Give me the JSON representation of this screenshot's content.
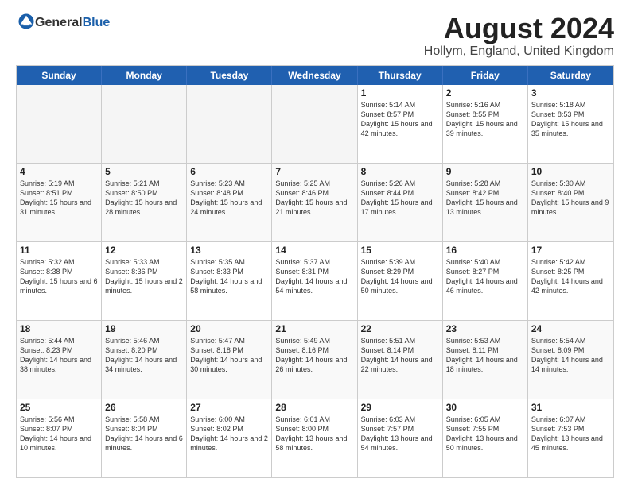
{
  "header": {
    "logo": {
      "general": "General",
      "blue": "Blue"
    },
    "title": "August 2024",
    "subtitle": "Hollym, England, United Kingdom"
  },
  "calendar": {
    "weekdays": [
      "Sunday",
      "Monday",
      "Tuesday",
      "Wednesday",
      "Thursday",
      "Friday",
      "Saturday"
    ],
    "rows": [
      [
        {
          "day": "",
          "empty": true
        },
        {
          "day": "",
          "empty": true
        },
        {
          "day": "",
          "empty": true
        },
        {
          "day": "",
          "empty": true
        },
        {
          "day": "1",
          "detail": "Sunrise: 5:14 AM\nSunset: 8:57 PM\nDaylight: 15 hours\nand 42 minutes."
        },
        {
          "day": "2",
          "detail": "Sunrise: 5:16 AM\nSunset: 8:55 PM\nDaylight: 15 hours\nand 39 minutes."
        },
        {
          "day": "3",
          "detail": "Sunrise: 5:18 AM\nSunset: 8:53 PM\nDaylight: 15 hours\nand 35 minutes."
        }
      ],
      [
        {
          "day": "4",
          "detail": "Sunrise: 5:19 AM\nSunset: 8:51 PM\nDaylight: 15 hours\nand 31 minutes."
        },
        {
          "day": "5",
          "detail": "Sunrise: 5:21 AM\nSunset: 8:50 PM\nDaylight: 15 hours\nand 28 minutes."
        },
        {
          "day": "6",
          "detail": "Sunrise: 5:23 AM\nSunset: 8:48 PM\nDaylight: 15 hours\nand 24 minutes."
        },
        {
          "day": "7",
          "detail": "Sunrise: 5:25 AM\nSunset: 8:46 PM\nDaylight: 15 hours\nand 21 minutes."
        },
        {
          "day": "8",
          "detail": "Sunrise: 5:26 AM\nSunset: 8:44 PM\nDaylight: 15 hours\nand 17 minutes."
        },
        {
          "day": "9",
          "detail": "Sunrise: 5:28 AM\nSunset: 8:42 PM\nDaylight: 15 hours\nand 13 minutes."
        },
        {
          "day": "10",
          "detail": "Sunrise: 5:30 AM\nSunset: 8:40 PM\nDaylight: 15 hours\nand 9 minutes."
        }
      ],
      [
        {
          "day": "11",
          "detail": "Sunrise: 5:32 AM\nSunset: 8:38 PM\nDaylight: 15 hours\nand 6 minutes."
        },
        {
          "day": "12",
          "detail": "Sunrise: 5:33 AM\nSunset: 8:36 PM\nDaylight: 15 hours\nand 2 minutes."
        },
        {
          "day": "13",
          "detail": "Sunrise: 5:35 AM\nSunset: 8:33 PM\nDaylight: 14 hours\nand 58 minutes."
        },
        {
          "day": "14",
          "detail": "Sunrise: 5:37 AM\nSunset: 8:31 PM\nDaylight: 14 hours\nand 54 minutes."
        },
        {
          "day": "15",
          "detail": "Sunrise: 5:39 AM\nSunset: 8:29 PM\nDaylight: 14 hours\nand 50 minutes."
        },
        {
          "day": "16",
          "detail": "Sunrise: 5:40 AM\nSunset: 8:27 PM\nDaylight: 14 hours\nand 46 minutes."
        },
        {
          "day": "17",
          "detail": "Sunrise: 5:42 AM\nSunset: 8:25 PM\nDaylight: 14 hours\nand 42 minutes."
        }
      ],
      [
        {
          "day": "18",
          "detail": "Sunrise: 5:44 AM\nSunset: 8:23 PM\nDaylight: 14 hours\nand 38 minutes."
        },
        {
          "day": "19",
          "detail": "Sunrise: 5:46 AM\nSunset: 8:20 PM\nDaylight: 14 hours\nand 34 minutes."
        },
        {
          "day": "20",
          "detail": "Sunrise: 5:47 AM\nSunset: 8:18 PM\nDaylight: 14 hours\nand 30 minutes."
        },
        {
          "day": "21",
          "detail": "Sunrise: 5:49 AM\nSunset: 8:16 PM\nDaylight: 14 hours\nand 26 minutes."
        },
        {
          "day": "22",
          "detail": "Sunrise: 5:51 AM\nSunset: 8:14 PM\nDaylight: 14 hours\nand 22 minutes."
        },
        {
          "day": "23",
          "detail": "Sunrise: 5:53 AM\nSunset: 8:11 PM\nDaylight: 14 hours\nand 18 minutes."
        },
        {
          "day": "24",
          "detail": "Sunrise: 5:54 AM\nSunset: 8:09 PM\nDaylight: 14 hours\nand 14 minutes."
        }
      ],
      [
        {
          "day": "25",
          "detail": "Sunrise: 5:56 AM\nSunset: 8:07 PM\nDaylight: 14 hours\nand 10 minutes."
        },
        {
          "day": "26",
          "detail": "Sunrise: 5:58 AM\nSunset: 8:04 PM\nDaylight: 14 hours\nand 6 minutes."
        },
        {
          "day": "27",
          "detail": "Sunrise: 6:00 AM\nSunset: 8:02 PM\nDaylight: 14 hours\nand 2 minutes."
        },
        {
          "day": "28",
          "detail": "Sunrise: 6:01 AM\nSunset: 8:00 PM\nDaylight: 13 hours\nand 58 minutes."
        },
        {
          "day": "29",
          "detail": "Sunrise: 6:03 AM\nSunset: 7:57 PM\nDaylight: 13 hours\nand 54 minutes."
        },
        {
          "day": "30",
          "detail": "Sunrise: 6:05 AM\nSunset: 7:55 PM\nDaylight: 13 hours\nand 50 minutes."
        },
        {
          "day": "31",
          "detail": "Sunrise: 6:07 AM\nSunset: 7:53 PM\nDaylight: 13 hours\nand 45 minutes."
        }
      ]
    ]
  }
}
